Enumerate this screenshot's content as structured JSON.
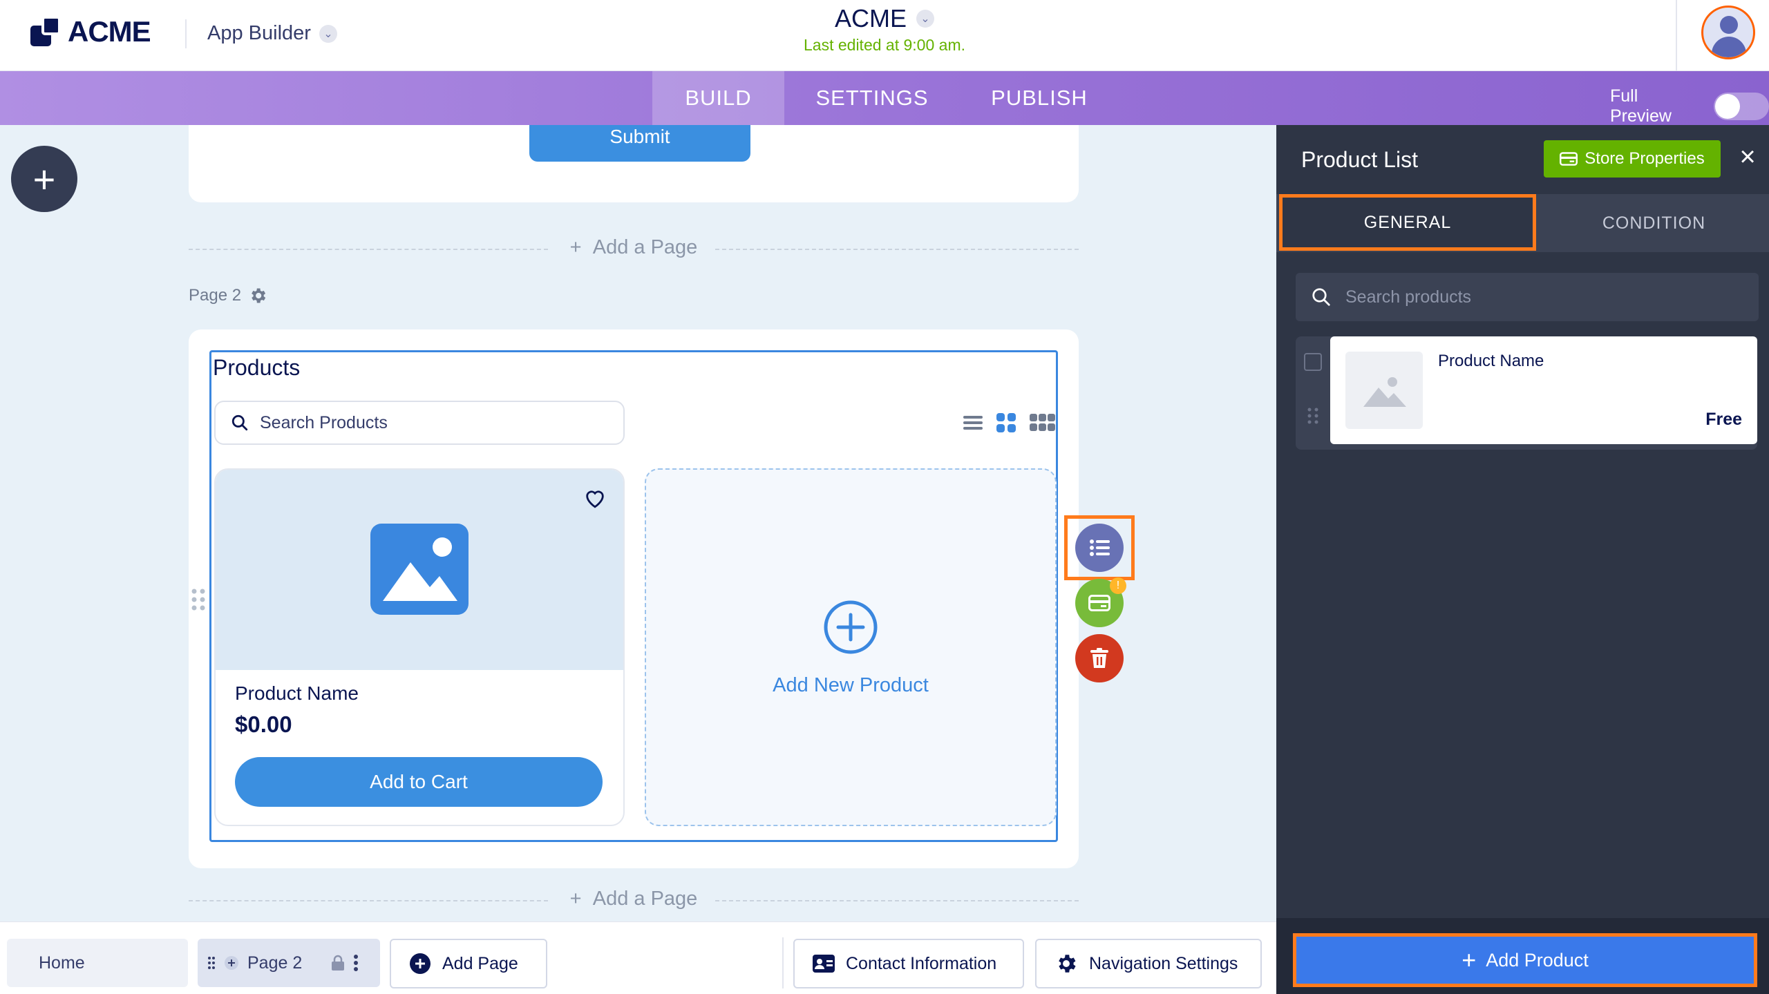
{
  "header": {
    "logo_text": "ACME",
    "app_builder_label": "App Builder",
    "app_name": "ACME",
    "last_edited": "Last edited at 9:00 am."
  },
  "nav": {
    "tabs": [
      {
        "label": "BUILD",
        "active": true
      },
      {
        "label": "SETTINGS",
        "active": false
      },
      {
        "label": "PUBLISH",
        "active": false
      }
    ],
    "full_preview_label": "Full Preview"
  },
  "canvas": {
    "submit_label": "Submit",
    "add_page_label": "Add a Page",
    "page_label": "Page 2",
    "products_title": "Products",
    "search_placeholder": "Search Products",
    "product": {
      "name": "Product Name",
      "price": "$0.00",
      "add_to_cart": "Add to Cart"
    },
    "add_new_product": "Add New Product",
    "warning_badge": "!"
  },
  "bottombar": {
    "home": "Home",
    "page2": "Page 2",
    "add_page": "Add Page",
    "contact_info": "Contact Information",
    "nav_settings": "Navigation Settings"
  },
  "panel": {
    "title": "Product List",
    "store_properties": "Store Properties",
    "tabs": {
      "general": "GENERAL",
      "condition": "CONDITION"
    },
    "search_placeholder": "Search products",
    "items": [
      {
        "name": "Product Name",
        "price": "Free"
      }
    ],
    "add_product": "Add Product"
  },
  "colors": {
    "accent_blue": "#3b8fe0",
    "nav_purple": "#9a74d8",
    "highlight_orange": "#ff7b1c",
    "green": "#64b200",
    "panel_dark": "#2e3545"
  }
}
